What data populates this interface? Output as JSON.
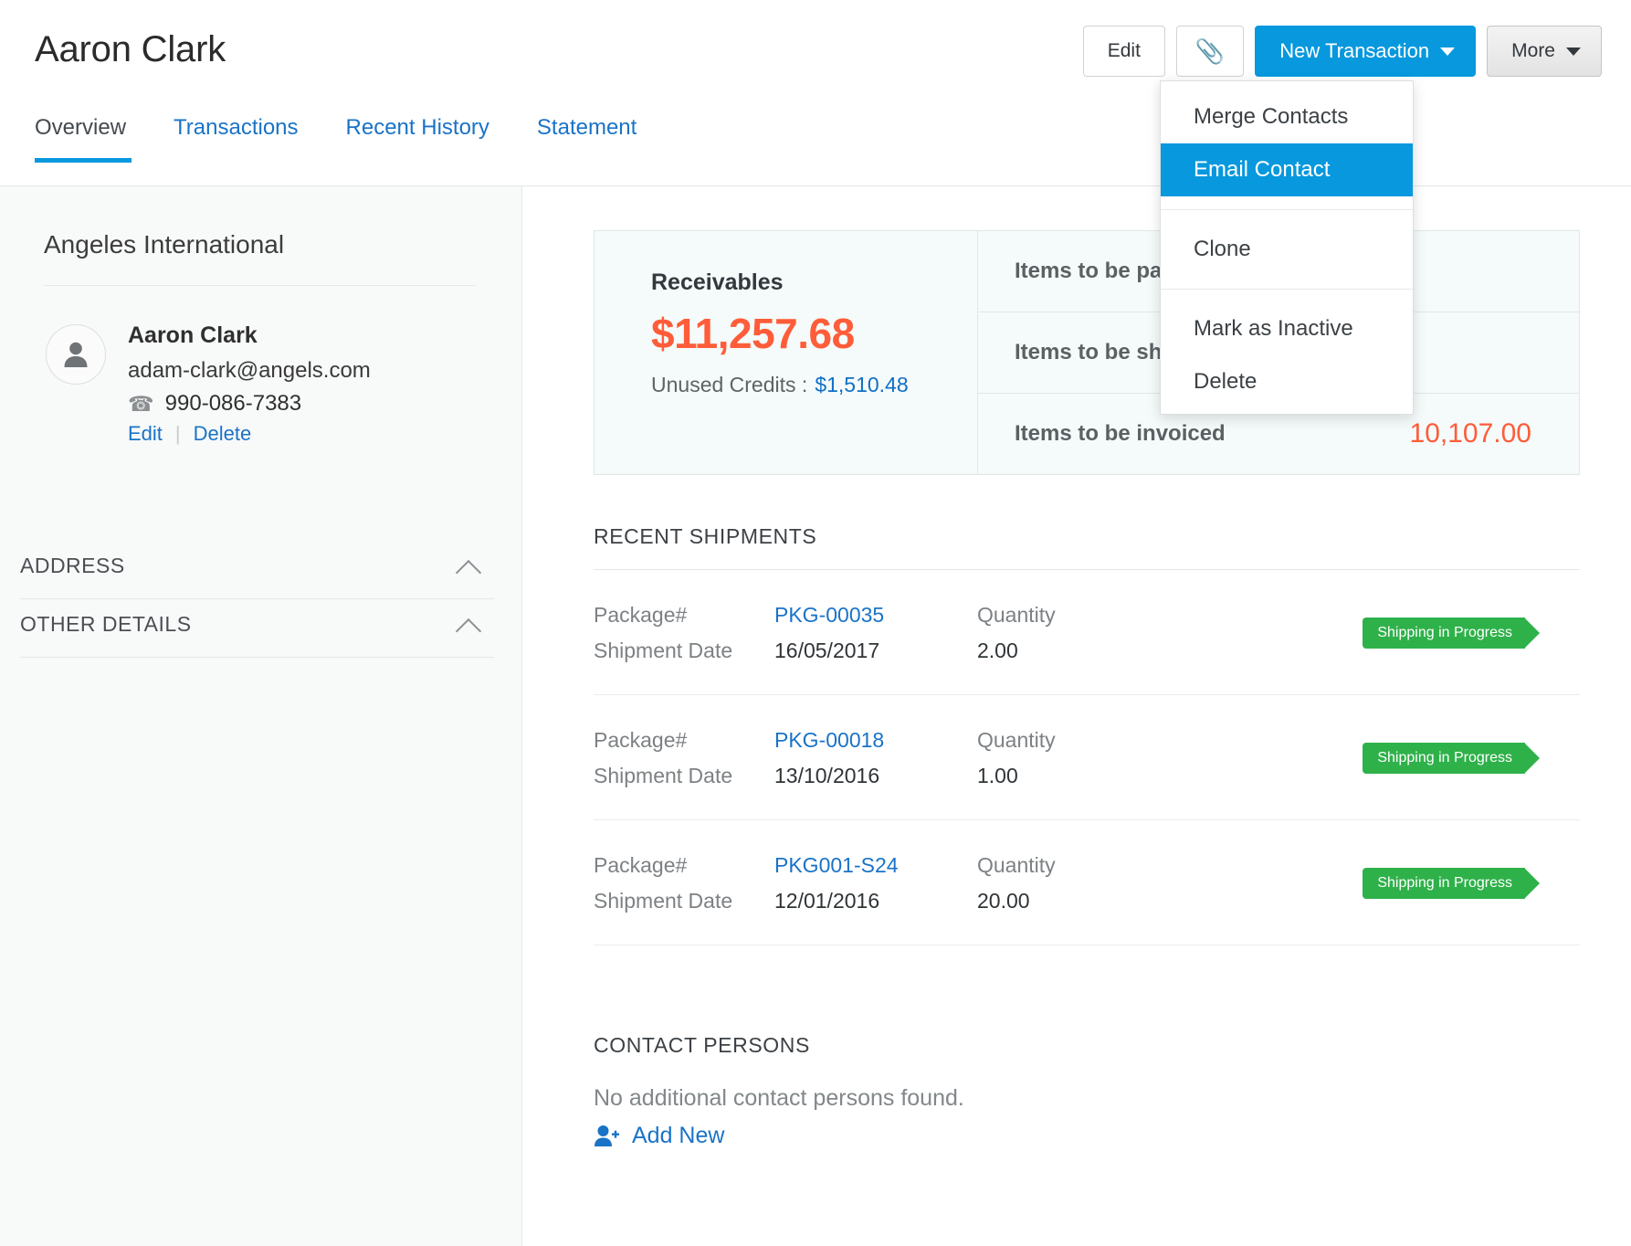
{
  "header": {
    "title": "Aaron Clark",
    "actions": {
      "edit_label": "Edit",
      "attachment_icon": "paperclip-icon",
      "new_transaction_label": "New Transaction",
      "more_label": "More"
    }
  },
  "tabs": [
    {
      "label": "Overview",
      "active": true
    },
    {
      "label": "Transactions",
      "active": false
    },
    {
      "label": "Recent History",
      "active": false
    },
    {
      "label": "Statement",
      "active": false
    }
  ],
  "more_menu": {
    "items": [
      {
        "label": "Merge Contacts",
        "highlight": false
      },
      {
        "label": "Email Contact",
        "highlight": true
      },
      {
        "label": "Clone",
        "highlight": false
      },
      {
        "label": "Mark as Inactive",
        "highlight": false
      },
      {
        "label": "Delete",
        "highlight": false
      }
    ]
  },
  "sidebar": {
    "org_name": "Angeles International",
    "contact": {
      "name": "Aaron Clark",
      "email": "adam-clark@angels.com",
      "phone": "990-086-7383",
      "phone_icon": "telephone-icon",
      "avatar_icon": "user-avatar-icon",
      "edit_label": "Edit",
      "delete_label": "Delete"
    },
    "sections": [
      {
        "label": "ADDRESS",
        "chevron": "chevron-up-icon"
      },
      {
        "label": "OTHER DETAILS",
        "chevron": "chevron-up-icon"
      }
    ]
  },
  "summary": {
    "receivables_label": "Receivables",
    "receivables_amount": "$11,257.68",
    "unused_credits_label": "Unused Credits :",
    "unused_credits_amount": "$1,510.48",
    "rows": [
      {
        "label": "Items to be packed",
        "value": ""
      },
      {
        "label": "Items to be shipped",
        "value": ""
      },
      {
        "label": "Items to be invoiced",
        "value": "10,107.00"
      }
    ]
  },
  "shipments": {
    "title": "RECENT SHIPMENTS",
    "package_key": "Package#",
    "date_key": "Shipment Date",
    "quantity_key": "Quantity",
    "rows": [
      {
        "package": "PKG-00035",
        "date": "16/05/2017",
        "quantity": "2.00",
        "status": "Shipping in Progress"
      },
      {
        "package": "PKG-00018",
        "date": "13/10/2016",
        "quantity": "1.00",
        "status": "Shipping in Progress"
      },
      {
        "package": "PKG001-S24",
        "date": "12/01/2016",
        "quantity": "20.00",
        "status": "Shipping in Progress"
      }
    ]
  },
  "contact_persons": {
    "title": "CONTACT PERSONS",
    "empty_message": "No additional contact persons found.",
    "add_new_label": "Add New",
    "add_new_icon": "add-user-icon"
  },
  "colors": {
    "accent_blue": "#0798dd",
    "link_blue": "#1a73c7",
    "amount_orange": "#ff5c39",
    "status_green": "#2fb14a",
    "card_bg": "#f4fbfa",
    "sidebar_bg": "#f8f9f9"
  }
}
